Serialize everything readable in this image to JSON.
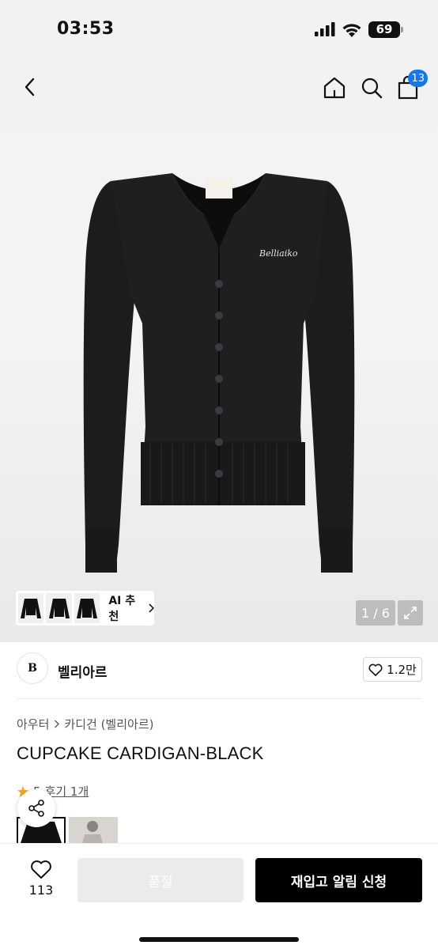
{
  "status_bar": {
    "time": "03:53",
    "battery": "69"
  },
  "nav": {
    "cart_count": "13"
  },
  "gallery": {
    "ai_label": "AI 추천",
    "page_indicator": "1 / 6",
    "garment_logo_text": "Belliaiko"
  },
  "brand": {
    "logo_text": "B",
    "name": "벨리아르",
    "like_count": "1.2만"
  },
  "breadcrumb": {
    "category": "아우터",
    "subcategory": "카디건 (벨리아르)"
  },
  "product": {
    "title": "CUPCAKE CARDIGAN-BLACK",
    "rating": "5",
    "review_label": "후기 1개"
  },
  "bottom_bar": {
    "wish_count": "113",
    "soldout_label": "품절",
    "notify_label": "재입고 알림 신청"
  },
  "colors": {
    "accent_badge": "#1677e8",
    "cta": "#000000",
    "disabled": "#ebebeb",
    "star": "#f5a623"
  }
}
